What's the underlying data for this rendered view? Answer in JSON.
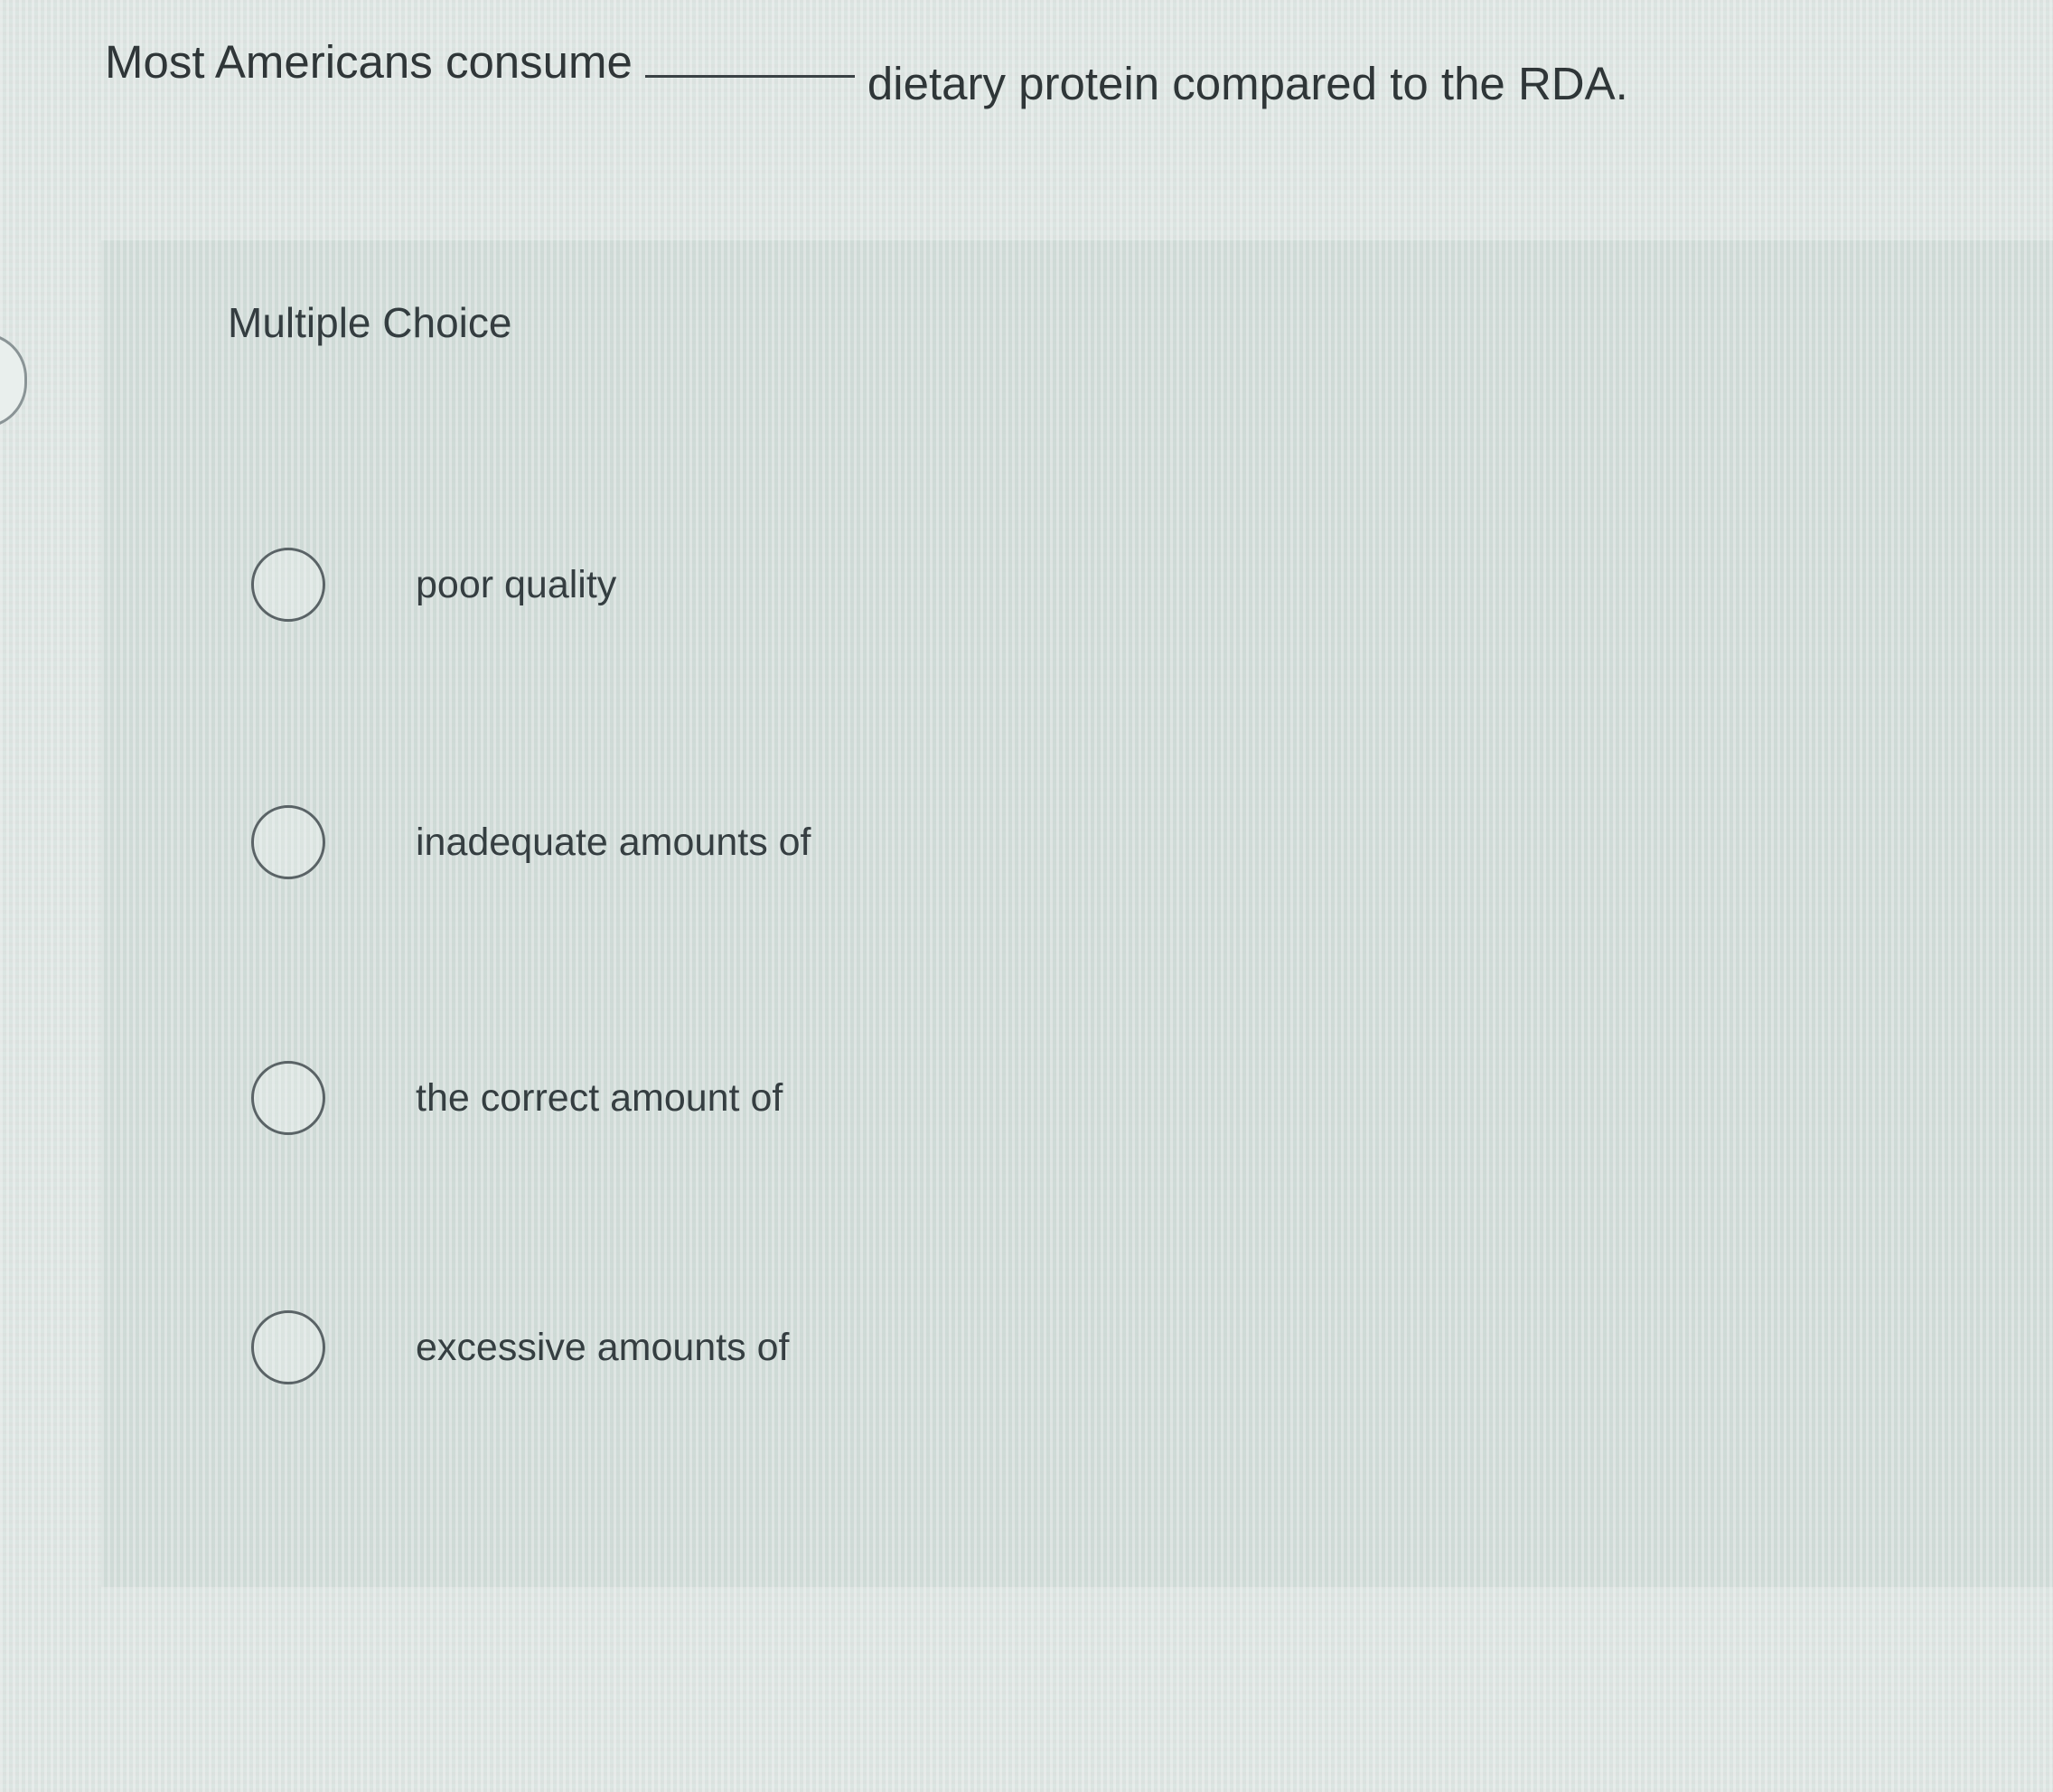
{
  "question": {
    "text_before": "Most Americans consume",
    "text_after": "dietary protein compared to the RDA."
  },
  "section": {
    "label": "Multiple Choice"
  },
  "options": [
    {
      "label": "poor quality",
      "selected": false
    },
    {
      "label": "inadequate amounts of",
      "selected": false
    },
    {
      "label": "the correct amount of",
      "selected": false
    },
    {
      "label": "excessive amounts of",
      "selected": false
    }
  ],
  "icons": {
    "radio": "radio-circle-icon"
  }
}
